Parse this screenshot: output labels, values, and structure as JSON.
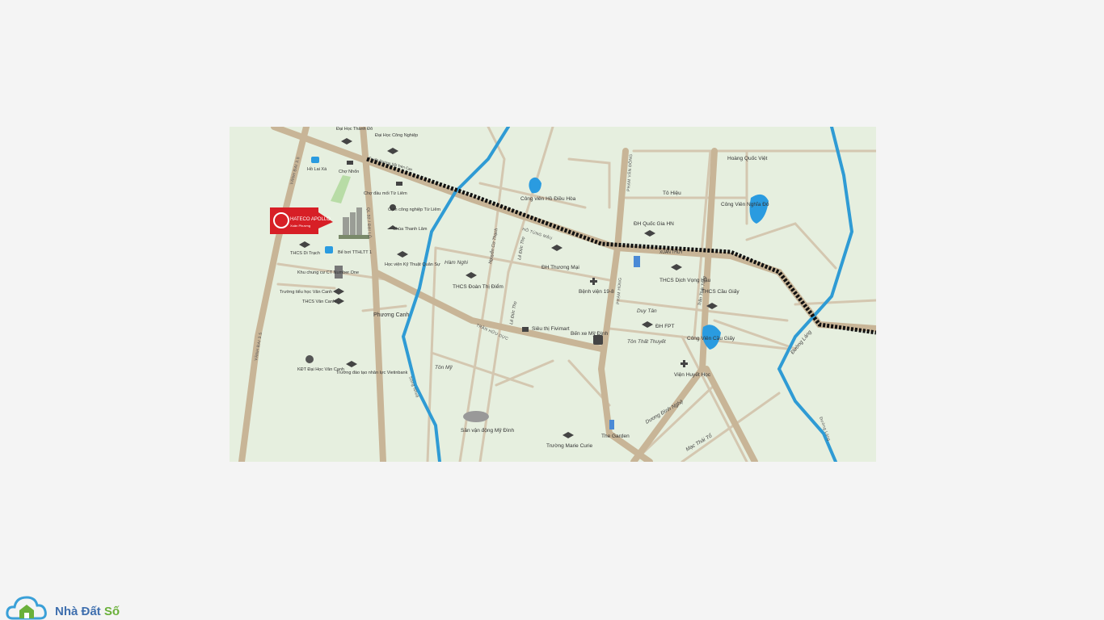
{
  "colors": {
    "page_bg": "#f4f4f4",
    "map_bg": "#e6efdf",
    "road_major": "#c8b597",
    "road_minor": "#d4c7b0",
    "river": "#2f9bd4",
    "lake": "#2a9be0",
    "brand_red": "#d71f26",
    "rail": "#111111"
  },
  "marker": {
    "brand_top": "HATECO APOLLO",
    "brand_sub": "Xuân Phương"
  },
  "labels": {
    "dh_thanh_do": "Đại Học Thành Đô",
    "dh_cong_nghiep": "Đại Học Công Nghiệp",
    "ho_lai_xa": "Hồ Lai Xá",
    "cho_nhon": "Chợ Nhổn",
    "cho_dau_moi": "Chợ đầu mối Từ Liêm",
    "cum_cn": "Cụm công nghiệp Từ Liêm",
    "chua_thanh_lam": "Chùa Thanh Lâm",
    "thcs_di_trach": "THCS Di Trạch",
    "be_boi": "Bể bơi TTHLTT 1",
    "hv_ktqs": "Học viện Kỹ Thuật Quân Sự",
    "khu_chung_cu": "Khu chung cư CT Number One",
    "th_van_canh": "Trường tiểu học Vân Canh",
    "thcs_van_canh": "THCS Vân Canh",
    "phuong_canh": "Phương Canh",
    "kdt_van_canh": "KĐT Đại Học Vân Canh",
    "truong_vietinbank": "Trường đào tạo nhân lực Vietinbank",
    "cv_ho_dieu_hoa": "Công viên Hồ Điều Hòa",
    "ham_nghi": "Hàm Nghi",
    "nguyen_co_thach": "Nguyễn Cơ Thạch",
    "le_duc_tho_1": "Lê Đức Thọ",
    "le_duc_tho_2": "Lê Đức Thọ",
    "thcs_doan_thi_diem": "THCS Đoàn Thị Điểm",
    "dh_thuong_mai": "ĐH Thương Mại",
    "benh_vien_198": "Bệnh viện 19-8",
    "sieu_thi_fivimart": "Siêu thị Fivimart",
    "ben_xe_my_dinh": "Bến xe Mỹ Đình",
    "ton_my": "Tôn Mỹ",
    "svd_my_dinh": "Sân vận động Mỹ Đình",
    "truong_marie_curie": "Trường Marie Curie",
    "the_garden": "The Garden",
    "hoang_quoc_viet": "Hoàng Quốc Việt",
    "to_hieu": "Tô Hiệu",
    "cv_nghia_do": "Công Viên Nghĩa Đô",
    "dh_qghn": "ĐH Quốc Gia HN",
    "xuan_thuy": "XUÂN THỦY",
    "iph_plaza": "IPH Plaza",
    "thcs_dich_vong_hau": "THCS Dịch Vọng Hậu",
    "thcs_cau_giay": "THCS Cầu Giấy",
    "tran_thai_tong": "Trần Thái Tông",
    "duy_tan": "Duy Tân",
    "dh_fpt": "ĐH FPT",
    "ton_that_thuyet": "Tôn Thất Thuyết",
    "cv_cau_giay": "Công Viên Cầu Giấy",
    "vien_huyet_hoc": "Viện Huyết Học",
    "duong_dinh_nghe": "Dương Đình Nghệ",
    "mac_thai_to": "Mạc Thái Tổ",
    "duong_lang": "Đường Láng",
    "tuyen_sat": "Tuyến Đường Sắt Trên Cao"
  },
  "road_labels_vertical": {
    "vanh_dai_35_top": "VÀNH ĐAI 3.5",
    "vanh_dai_35_bot": "VÀNH ĐAI 3.5",
    "road_72": "QL 32 / ĐẠI LỘ",
    "pham_van_dong": "PHẠM VĂN ĐỒNG",
    "pham_hung": "PHẠM HÙNG",
    "ho_tung_mau": "HỒ TÙNG MẬU",
    "tran_huu_duc": "TRẦN HỮU DỰC",
    "song_nhue": "Sông Nhuệ",
    "duong_lang2": "Đường Láng"
  },
  "brand": {
    "text_a": "Nhà Đất ",
    "text_b": "Số"
  }
}
